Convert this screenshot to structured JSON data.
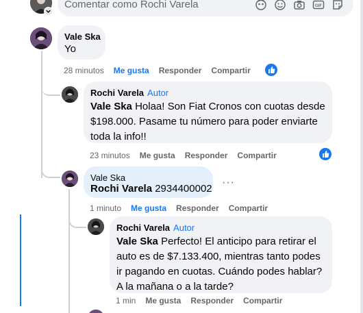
{
  "composer": {
    "placeholder": "Comentar como Rochi Varela",
    "icons": [
      "avatar-sticker-icon",
      "emoji-icon",
      "camera-icon",
      "gif-icon",
      "sticker-icon"
    ],
    "gif_label": "GIF"
  },
  "comments": [
    {
      "author": "Vale Ska",
      "text": "Yo",
      "time": "28 minutos",
      "like_label": "Me gusta",
      "reply_label": "Responder",
      "share_label": "Compartir",
      "liked": true
    },
    {
      "author": "Rochi Varela",
      "badge": "Autor",
      "mention": "Vale Ska",
      "text_lines": [
        "Holaa! Son Fiat Cronos con cuotas desde",
        "$198.000. Pasame tu número para poder enviarte",
        "toda la info!!"
      ],
      "time": "23 minutos",
      "like_label": "Me gusta",
      "reply_label": "Responder",
      "share_label": "Compartir"
    },
    {
      "author": "Vale Ska",
      "mention": "Rochi Varela",
      "text": "2934400002",
      "time": "1 minuto",
      "like_label": "Me gusta",
      "reply_label": "Responder",
      "share_label": "Compartir",
      "more": "···"
    },
    {
      "author": "Rochi Varela",
      "badge": "Autor",
      "mention": "Vale Ska",
      "text_lines": [
        "Perfecto! El anticipo para retirar el",
        "auto es de $7.133.400, mientras tanto podes",
        "ir pagando en cuotas. Cuándo podes hablar?",
        "A la mañana o a la tarde?"
      ],
      "time": "1 min",
      "like_label": "Me gusta",
      "reply_label": "Responder",
      "share_label": "Compartir"
    }
  ],
  "colors": {
    "accent": "#1877f2",
    "bubble": "#f0f2f5",
    "highlight_bubble": "#e4effc",
    "meta_text": "#65676b"
  }
}
